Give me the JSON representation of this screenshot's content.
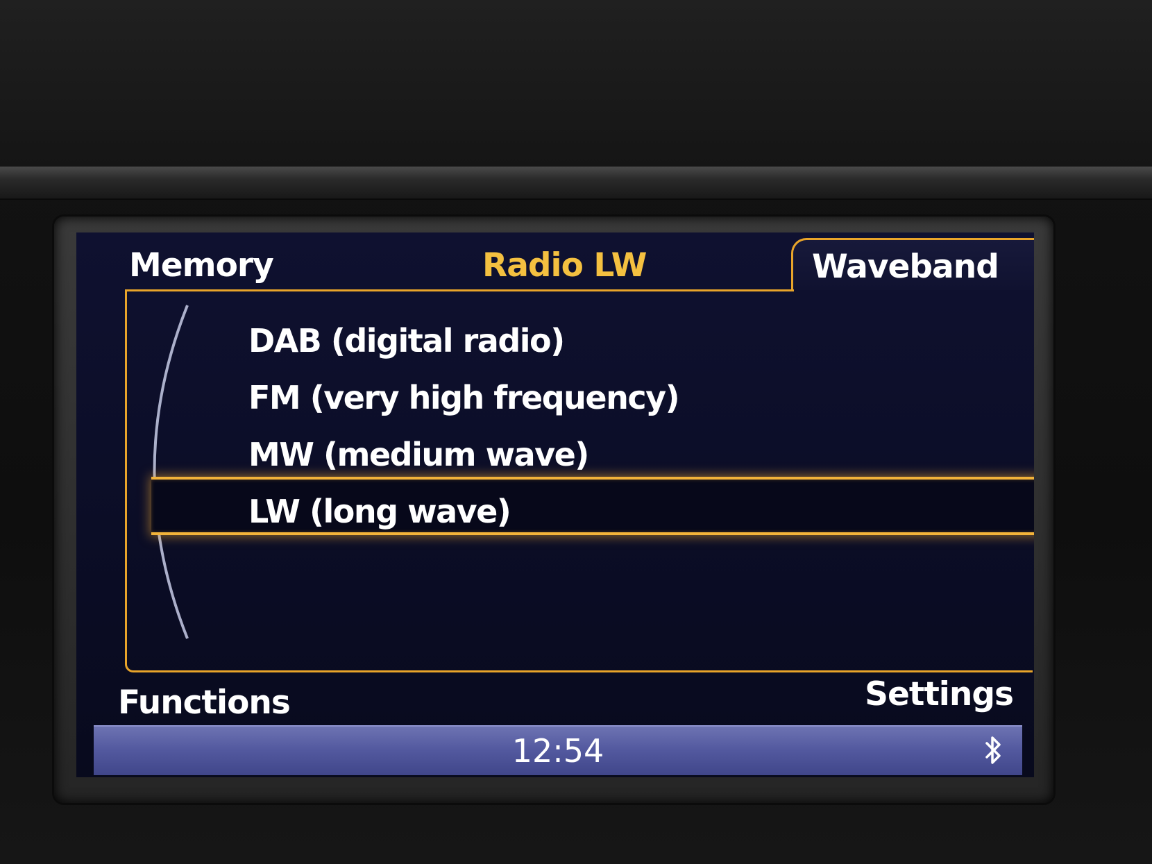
{
  "header": {
    "left_tab_label": "Memory",
    "title": "Radio LW",
    "active_tab_label": "Waveband"
  },
  "waveband_list": {
    "items": [
      {
        "label": "DAB (digital radio)",
        "selected": false
      },
      {
        "label": "FM (very high frequency)",
        "selected": false
      },
      {
        "label": "MW (medium wave)",
        "selected": false
      },
      {
        "label": "LW (long wave)",
        "selected": true
      }
    ]
  },
  "footer": {
    "left_label": "Functions",
    "right_label": "Settings"
  },
  "status_bar": {
    "time": "12:54",
    "icons": [
      "bluetooth-icon"
    ]
  },
  "colors": {
    "accent": "#e8a42a",
    "title_accent": "#f4c040",
    "screen_background": "#0f1130",
    "status_bar": "#545aa0",
    "text": "#ffffff"
  }
}
